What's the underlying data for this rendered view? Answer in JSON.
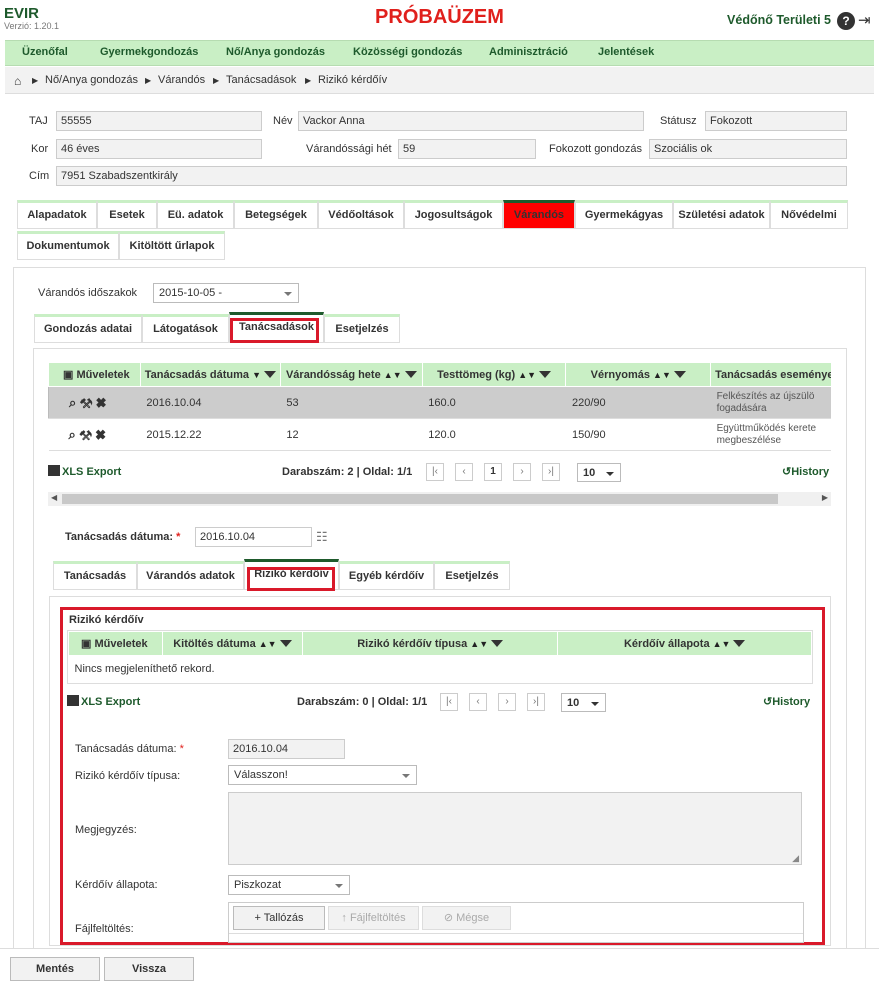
{
  "header": {
    "brand": "EVIR",
    "version": "Verzió: 1.20.1",
    "title": "PRÓBAÜZEM",
    "user": "Védőnő Területi 5"
  },
  "menu": [
    "Üzenőfal",
    "Gyermekgondozás",
    "Nő/Anya gondozás",
    "Közösségi gondozás",
    "Adminisztráció",
    "Jelentések"
  ],
  "breadcrumb": [
    "Nő/Anya gondozás",
    "Várandós",
    "Tanácsadások",
    "Rizikó kérdőív"
  ],
  "patient": {
    "taj_label": "TAJ",
    "taj": "55555",
    "nev_label": "Név",
    "nev": "Vackor Anna",
    "status_label": "Státusz",
    "status": "Fokozott",
    "kor_label": "Kor",
    "kor": "46 éves",
    "het_label": "Várandóssági hét",
    "het": "59",
    "fokozott_label": "Fokozott gondozás",
    "fokozott": "Szociális ok",
    "cim_label": "Cím",
    "cim": "7951 Szabadszentkirály"
  },
  "main_tabs": [
    "Alapadatok",
    "Esetek",
    "Eü. adatok",
    "Betegségek",
    "Védőoltások",
    "Jogosultságok",
    "Várandós",
    "Gyermekágyas",
    "Születési adatok",
    "Nővédelmi",
    "Dokumentumok",
    "Kitöltött űrlapok"
  ],
  "period": {
    "label": "Várandós időszakok",
    "value": "2015-10-05 -"
  },
  "sub_tabs": [
    "Gondozás adatai",
    "Látogatások",
    "Tanácsadások",
    "Esetjelzés"
  ],
  "grid1": {
    "headers": [
      "Műveletek",
      "Tanácsadás dátuma",
      "Várandósság hete",
      "Testtömeg (kg)",
      "Vérnyomás",
      "Tanácsadás eseményei"
    ],
    "rows": [
      {
        "date": "2016.10.04",
        "week": "53",
        "weight": "160.0",
        "bp": "220/90",
        "event1": "Felkészítés az újszülö",
        "event2": "fogadására"
      },
      {
        "date": "2015.12.22",
        "week": "12",
        "weight": "120.0",
        "bp": "150/90",
        "event1": "Együttműködés kerete",
        "event2": "megbeszélése"
      }
    ],
    "xls": "XLS Export",
    "count": "Darabszám: 2 | Oldal: 1/1",
    "page": "1",
    "page_size": "10",
    "history": "History"
  },
  "detail": {
    "date_label": "Tanácsadás dátuma:",
    "date": "2016.10.04"
  },
  "detail_tabs": [
    "Tanácsadás",
    "Várandós adatok",
    "Rizikó kérdőív",
    "Egyéb kérdőív",
    "Esetjelzés"
  ],
  "rizikо": {
    "title": "Rizikó kérdőív",
    "headers": [
      "Műveletek",
      "Kitöltés dátuma",
      "Rizikó kérdőív típusa",
      "Kérdőív állapota"
    ],
    "empty": "Nincs megjeleníthető rekord.",
    "xls": "XLS Export",
    "count": "Darabszám: 0 | Oldal: 1/1",
    "page_size": "10",
    "history": "History"
  },
  "form": {
    "date_label": "Tanácsadás dátuma:",
    "date": "2016.10.04",
    "type_label": "Rizikó kérdőív típusa:",
    "type": "Válasszon!",
    "note_label": "Megjegyzés:",
    "state_label": "Kérdőív állapota:",
    "state": "Piszkozat",
    "file_label": "Fájlfeltöltés:",
    "browse": "Tallózás",
    "upload": "Fájlfeltöltés",
    "cancel": "Mégse"
  },
  "footer": {
    "save": "Mentés",
    "back": "Vissza"
  }
}
